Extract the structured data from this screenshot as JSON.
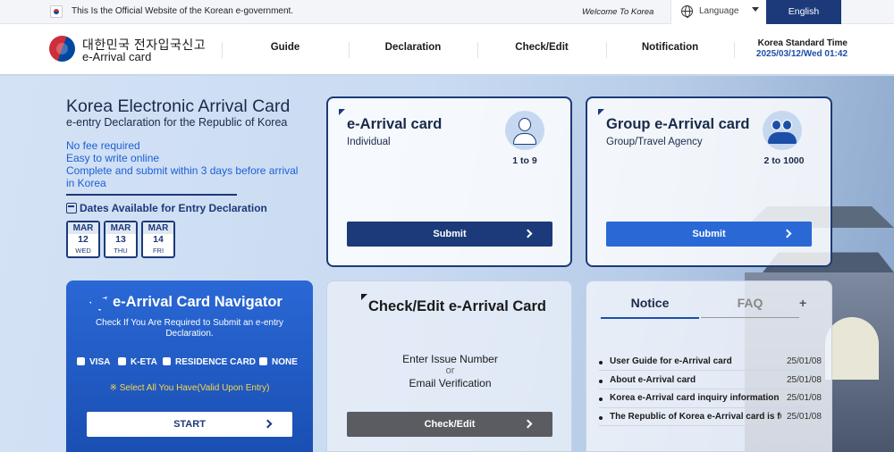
{
  "topbar": {
    "official_text": "This Is the Official Website of the Korean e-government.",
    "welcome": "Welcome To Korea",
    "language_label": "Language",
    "english_button": "English"
  },
  "header": {
    "logo_korean": "대한민국 전자입국신고",
    "logo_english": "e-Arrival card",
    "nav": [
      "Guide",
      "Declaration",
      "Check/Edit",
      "Notification"
    ],
    "kst_title": "Korea Standard Time",
    "kst_time": "2025/03/12/Wed 01:42"
  },
  "hero": {
    "title": "Korea Electronic Arrival Card",
    "subtitle": "e-entry Declaration for the Republic of Korea",
    "lines": [
      "No fee required",
      "Easy to write online",
      "Complete and submit within 3 days before arrival in Korea"
    ],
    "dates_title": "Dates Available for Entry Declaration",
    "dates": [
      {
        "month": "MAR",
        "day": "12",
        "dow": "WED"
      },
      {
        "month": "MAR",
        "day": "13",
        "dow": "THU"
      },
      {
        "month": "MAR",
        "day": "14",
        "dow": "FRI"
      }
    ]
  },
  "individual_card": {
    "title": "e-Arrival card",
    "subtitle": "Individual",
    "range": "1 to 9",
    "submit": "Submit"
  },
  "group_card": {
    "title": "Group e-Arrival card",
    "subtitle": "Group/Travel Agency",
    "range": "2 to 1000",
    "submit": "Submit"
  },
  "navigator": {
    "title": "e-Arrival Card Navigator",
    "description": "Check If You Are Required to Submit an e-entry Declaration.",
    "options": [
      "VISA",
      "K-ETA",
      "RESIDENCE CARD",
      "NONE"
    ],
    "note": "※ Select All You Have(Valid Upon Entry)",
    "start": "START"
  },
  "check_edit": {
    "title": "Check/Edit e-Arrival Card",
    "line1": "Enter Issue Number",
    "line2": "or",
    "line3": "Email Verification",
    "button": "Check/Edit"
  },
  "notice": {
    "tab_notice": "Notice",
    "tab_faq": "FAQ",
    "plus": "+",
    "items": [
      {
        "title": "User Guide for e-Arrival card",
        "date": "25/01/08"
      },
      {
        "title": "About e-Arrival card",
        "date": "25/01/08"
      },
      {
        "title": "Korea e-Arrival card inquiry information",
        "date": "25/01/08"
      },
      {
        "title": "The Republic of Korea e-Arrival card is fully implemented",
        "date": "25/01/08"
      }
    ]
  }
}
